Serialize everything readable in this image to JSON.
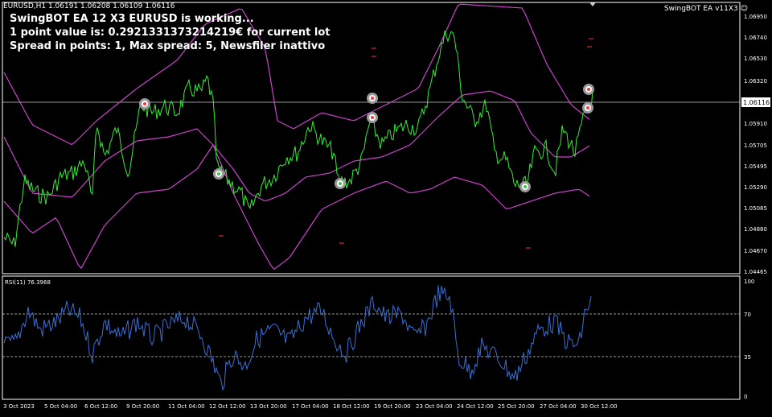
{
  "header": {
    "symbol_info": "EURUSD,H1  1.06191 1.06208 1.06109 1.06116",
    "ea_label": "SwingBOT EA v11X3 ☺"
  },
  "overlay": {
    "line1": "SwingBOT EA 12 X3 EURUSD is working...",
    "line2": "1 point value is: 0.2921331373214219€ for current lot",
    "line3": "Spread in points: 1, Max spread: 5, Newsfiler inattivo"
  },
  "price_axis": {
    "labels": [
      "1.06950",
      "1.06740",
      "1.06530",
      "1.06320",
      "1.05910",
      "1.05705",
      "1.05495",
      "1.05290",
      "1.05085",
      "1.04880",
      "1.04670",
      "1.04465"
    ],
    "current_price": "1.06116"
  },
  "rsi": {
    "title": "RSI(11) 76.3968",
    "levels": [
      "100",
      "70",
      "35",
      "0"
    ]
  },
  "time_axis": {
    "labels": [
      "3 Oct 2023",
      "5 Oct 04:00",
      "6 Oct 12:00",
      "9 Oct 20:00",
      "11 Oct 04:00",
      "12 Oct 12:00",
      "13 Oct 20:00",
      "17 Oct 04:00",
      "18 Oct 12:00",
      "19 Oct 20:00",
      "23 Oct 04:00",
      "24 Oct 12:00",
      "25 Oct 20:00",
      "27 Oct 04:00",
      "30 Oct 12:00"
    ]
  },
  "colors": {
    "price_line": "#33ee33",
    "band_line": "#cc44cc",
    "rsi_line": "#3a6fd6",
    "axis_text": "#ffffff",
    "grid": "#cccccc"
  },
  "chart_data": [
    {
      "type": "line",
      "series": [
        {
          "name": "EURUSD,H1",
          "values": []
        }
      ],
      "ylim": [
        1.04465,
        1.0705
      ]
    },
    {
      "type": "line",
      "series": [
        {
          "name": "RSI(11)",
          "values": []
        }
      ],
      "ylim": [
        0,
        100
      ]
    }
  ]
}
